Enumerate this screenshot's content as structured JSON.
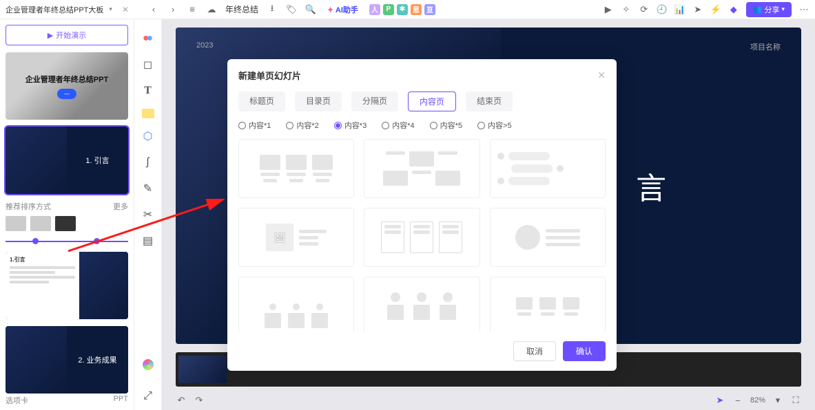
{
  "doc": {
    "title": "企业管理者年终总结PPT大板"
  },
  "toolbar": {
    "center_label": "年终总结",
    "ai_label": "AI助手",
    "share_label": "分享",
    "tags": [
      {
        "t": "人",
        "c": "#c8a8ff"
      },
      {
        "t": "P",
        "c": "#58c97a"
      },
      {
        "t": "✻",
        "c": "#5ac5c0"
      },
      {
        "t": "思",
        "c": "#ff9a5a"
      },
      {
        "t": "亘",
        "c": "#9a9aff"
      }
    ]
  },
  "left": {
    "start_label": "开始演示",
    "cover_title": "企业管理者年终总结PPT",
    "slide2_label": "1. 引言",
    "rec_label": "推荐排序方式",
    "rec_more": "更多",
    "slide4_hdr": "1.引言",
    "slide5_label": "2. 业务成果",
    "tab_left": "选项卡",
    "tab_right": "PPT"
  },
  "slide": {
    "year": "2023",
    "proj": "项目名称",
    "big_text": "言"
  },
  "modal": {
    "title": "新建单页幻灯片",
    "tabs": [
      "标题页",
      "目录页",
      "分隔页",
      "内容页",
      "结束页"
    ],
    "active_tab": 3,
    "radios": [
      "内容*1",
      "内容*2",
      "内容*3",
      "内容*4",
      "内容*5",
      "内容>5"
    ],
    "active_radio": 2,
    "cancel": "取消",
    "confirm": "确认"
  },
  "bottom": {
    "zoom": "82%"
  }
}
